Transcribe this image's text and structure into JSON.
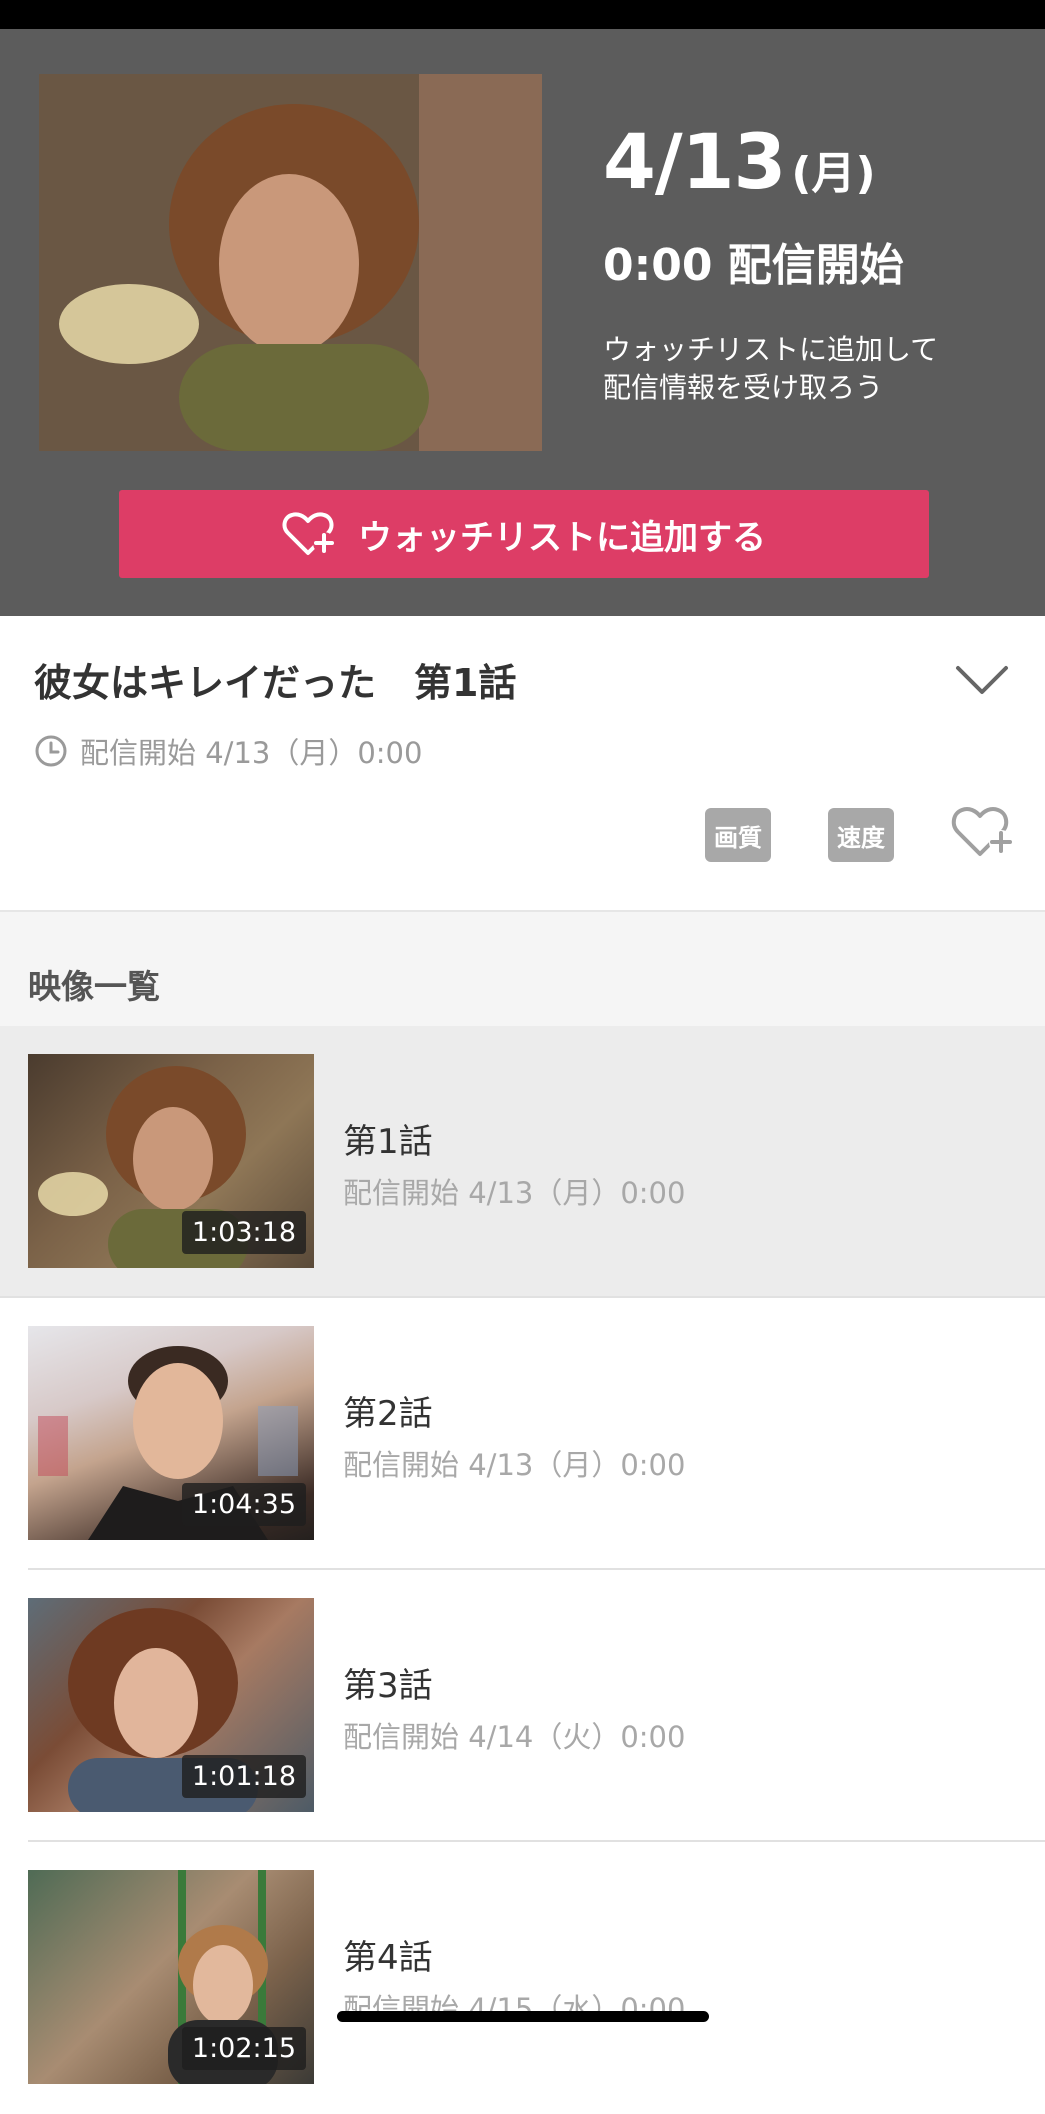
{
  "hero": {
    "date": "4/13",
    "weekday": "(月)",
    "start_time": "0:00 配信開始",
    "note_line1": "ウォッチリストに追加して",
    "note_line2": "配信情報を受け取ろう",
    "watchlist_button": "ウォッチリストに追加する"
  },
  "episode": {
    "title": "彼女はキレイだった　第1話",
    "release": "配信開始 4/13（月）0:00",
    "quality_label": "画質",
    "speed_label": "速度"
  },
  "list": {
    "header": "映像一覧",
    "items": [
      {
        "title": "第1話",
        "release": "配信開始 4/13（月）0:00",
        "duration": "1:03:18",
        "selected": true
      },
      {
        "title": "第2話",
        "release": "配信開始 4/13（月）0:00",
        "duration": "1:04:35",
        "selected": false
      },
      {
        "title": "第3話",
        "release": "配信開始 4/14（火）0:00",
        "duration": "1:01:18",
        "selected": false
      },
      {
        "title": "第4話",
        "release": "配信開始 4/15（水）0:00",
        "duration": "1:02:15",
        "selected": false
      }
    ]
  },
  "colors": {
    "accent": "#dd3d66",
    "hero_bg": "#5c5c5c",
    "chip_bg": "#a8a8a8"
  }
}
